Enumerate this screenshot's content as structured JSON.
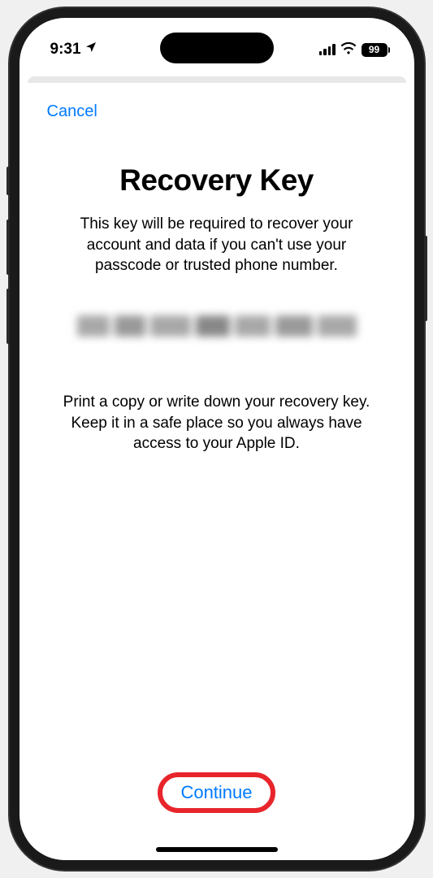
{
  "status_bar": {
    "time": "9:31",
    "battery_level": "99"
  },
  "nav": {
    "cancel_label": "Cancel"
  },
  "main": {
    "title": "Recovery Key",
    "description": "This key will be required to recover your account and data if you can't use your passcode or trusted phone number.",
    "instruction": "Print a copy or write down your recovery key. Keep it in a safe place so you always have access to your Apple ID."
  },
  "footer": {
    "continue_label": "Continue"
  }
}
